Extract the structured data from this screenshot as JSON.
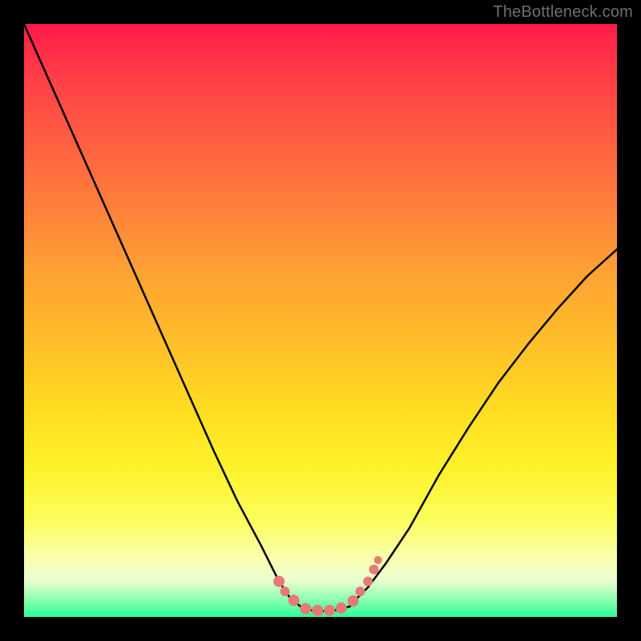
{
  "watermark": "TheBottleneck.com",
  "chart_data": {
    "type": "line",
    "title": "",
    "xlabel": "",
    "ylabel": "",
    "xlim": [
      0,
      1
    ],
    "ylim": [
      0,
      1
    ],
    "series": [
      {
        "name": "left-branch",
        "x": [
          0.0,
          0.04,
          0.08,
          0.12,
          0.16,
          0.2,
          0.24,
          0.28,
          0.32,
          0.36,
          0.4,
          0.43,
          0.45
        ],
        "y": [
          1.0,
          0.91,
          0.82,
          0.73,
          0.64,
          0.55,
          0.46,
          0.37,
          0.28,
          0.195,
          0.12,
          0.06,
          0.03
        ]
      },
      {
        "name": "right-branch",
        "x": [
          0.56,
          0.58,
          0.61,
          0.65,
          0.7,
          0.75,
          0.8,
          0.85,
          0.9,
          0.95,
          1.0
        ],
        "y": [
          0.03,
          0.05,
          0.09,
          0.15,
          0.24,
          0.32,
          0.395,
          0.46,
          0.52,
          0.575,
          0.62
        ]
      },
      {
        "name": "valley-floor",
        "x": [
          0.45,
          0.47,
          0.49,
          0.51,
          0.53,
          0.55,
          0.56
        ],
        "y": [
          0.03,
          0.015,
          0.01,
          0.01,
          0.012,
          0.018,
          0.03
        ]
      }
    ],
    "markers": [
      {
        "x": 0.43,
        "y": 0.06,
        "r": 7,
        "color": "#e77a76"
      },
      {
        "x": 0.44,
        "y": 0.043,
        "r": 6,
        "color": "#e77a76"
      },
      {
        "x": 0.455,
        "y": 0.028,
        "r": 7,
        "color": "#e77a76"
      },
      {
        "x": 0.475,
        "y": 0.014,
        "r": 7,
        "color": "#e77a76"
      },
      {
        "x": 0.495,
        "y": 0.011,
        "r": 7,
        "color": "#e77a76"
      },
      {
        "x": 0.515,
        "y": 0.011,
        "r": 7,
        "color": "#e77a76"
      },
      {
        "x": 0.535,
        "y": 0.015,
        "r": 7,
        "color": "#e77a76"
      },
      {
        "x": 0.555,
        "y": 0.027,
        "r": 7,
        "color": "#e77a76"
      },
      {
        "x": 0.567,
        "y": 0.043,
        "r": 6,
        "color": "#e77a76"
      },
      {
        "x": 0.58,
        "y": 0.06,
        "r": 6,
        "color": "#e77a76"
      },
      {
        "x": 0.59,
        "y": 0.08,
        "r": 6,
        "color": "#e77a76"
      },
      {
        "x": 0.597,
        "y": 0.096,
        "r": 5,
        "color": "#e77a76"
      }
    ],
    "background_gradient": {
      "direction": "vertical",
      "stops": [
        {
          "pos": 0.0,
          "color": "#ff1a4a"
        },
        {
          "pos": 0.3,
          "color": "#ff7d3c"
        },
        {
          "pos": 0.6,
          "color": "#ffdf22"
        },
        {
          "pos": 0.9,
          "color": "#fbffae"
        },
        {
          "pos": 1.0,
          "color": "#2bff98"
        }
      ]
    }
  }
}
